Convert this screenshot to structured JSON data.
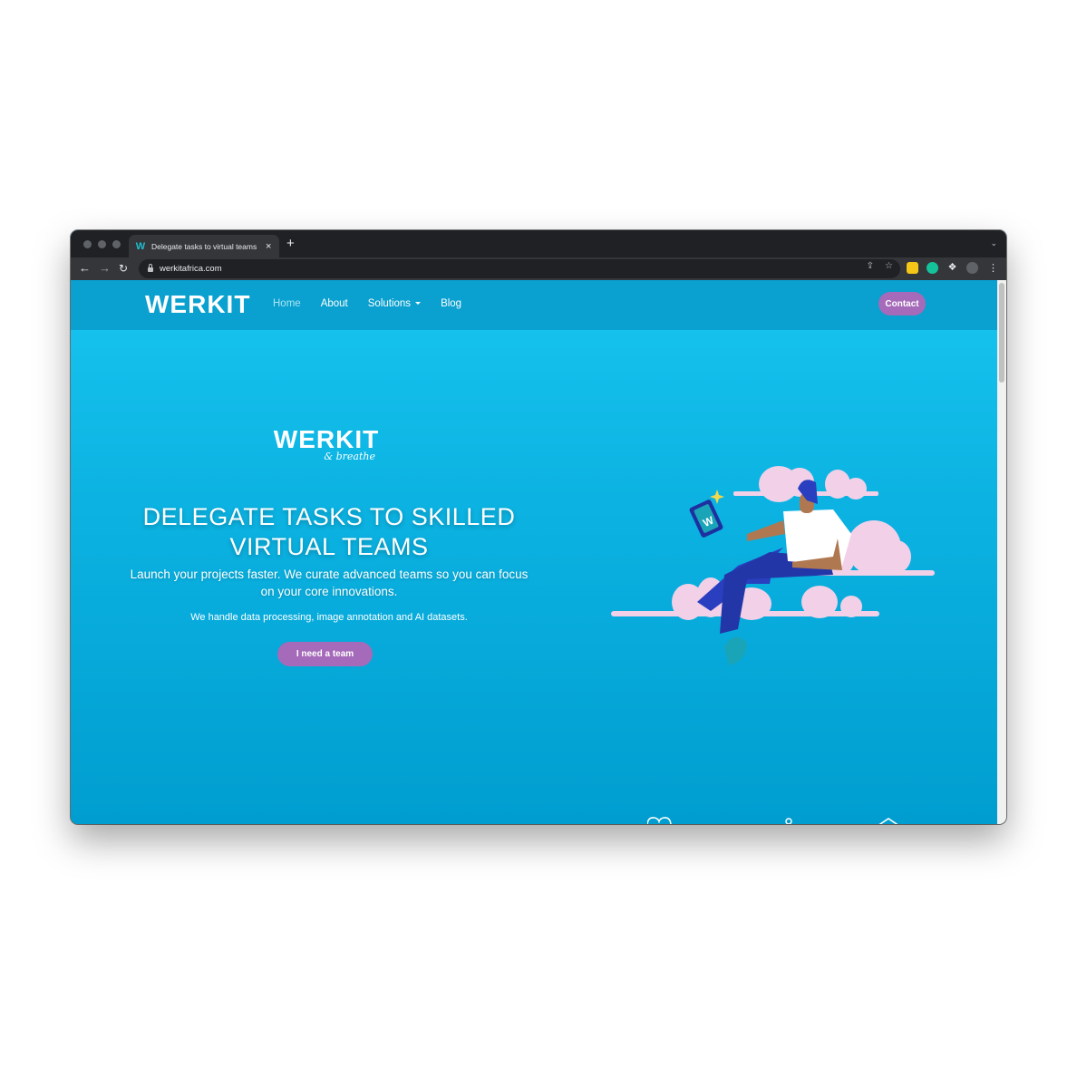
{
  "browser": {
    "tab_title": "Delegate tasks to virtual teams",
    "tab_close": "×",
    "new_tab": "+",
    "url": "werkitafrica.com"
  },
  "navbar": {
    "logo": "WERKIT",
    "links": [
      "Home",
      "About",
      "Solutions",
      "Blog"
    ],
    "contact": "Contact"
  },
  "hero": {
    "logo_word": "WERKIT",
    "logo_sub": "& breathe",
    "headline": "DELEGATE TASKS TO SKILLED VIRTUAL TEAMS",
    "subline": "Launch your projects faster. We curate advanced teams so you can focus on your core innovations.",
    "detail": "We handle data processing, image annotation and AI datasets.",
    "cta": "I need a team"
  },
  "colors": {
    "accent": "#a56ab9",
    "navbar": "#0aa0cf",
    "hero_top": "#18c5f0",
    "hero_bottom": "#009ed0",
    "cloud": "#f2d0e8",
    "figure_pants": "#2a3fbf"
  },
  "icons": [
    "lock-icon",
    "share-icon",
    "star-icon",
    "extension-icon",
    "menu-icon",
    "back-icon",
    "forward-icon",
    "reload-icon"
  ]
}
